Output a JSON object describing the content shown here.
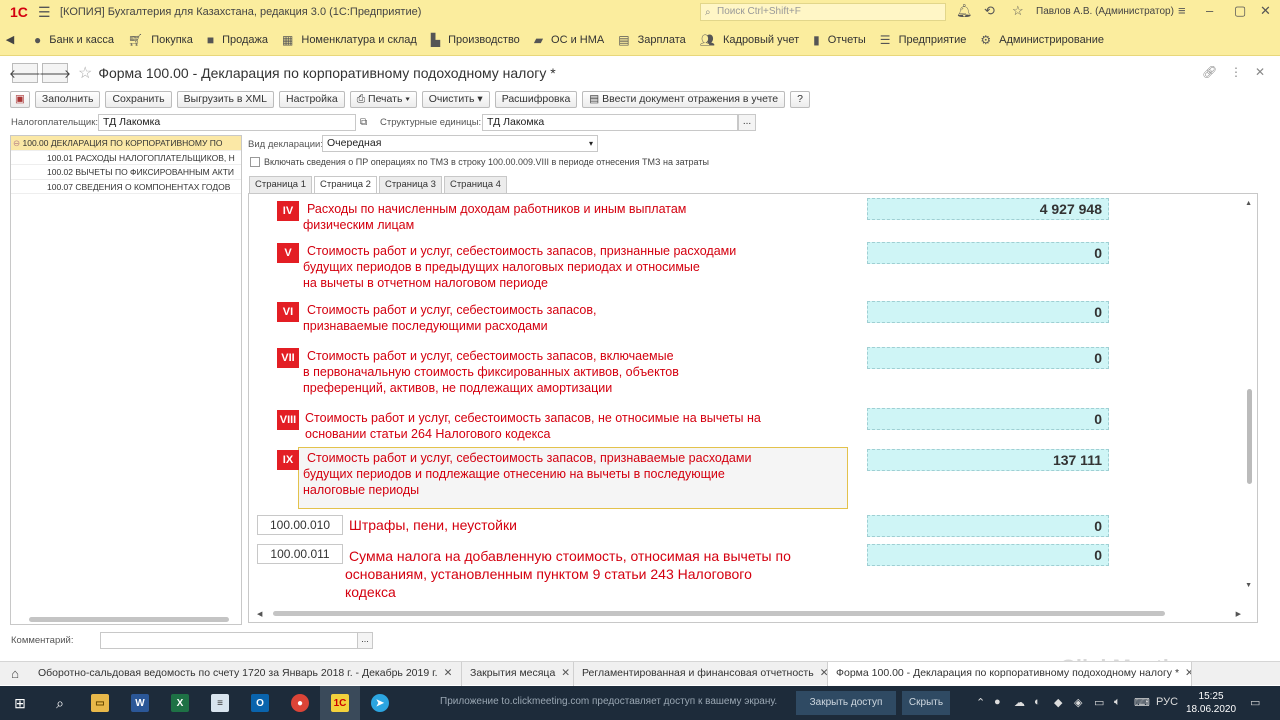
{
  "titlebar": {
    "app_title": "[КОПИЯ] Бухгалтерия для Казахстана, редакция 3.0  (1С:Предприятие)",
    "search_placeholder": "Поиск Ctrl+Shift+F",
    "user": "Павлов А.В. (Администратор)"
  },
  "main_menu": [
    {
      "label": "Банк и касса",
      "icon": "money-icon"
    },
    {
      "label": "Покупка",
      "icon": "cart-icon"
    },
    {
      "label": "Продажа",
      "icon": "bag-icon"
    },
    {
      "label": "Номенклатура и склад",
      "icon": "grid-icon"
    },
    {
      "label": "Производство",
      "icon": "factory-icon"
    },
    {
      "label": "ОС и НМА",
      "icon": "truck-icon"
    },
    {
      "label": "Зарплата",
      "icon": "wallet-icon"
    },
    {
      "label": "Кадровый учет",
      "icon": "people-icon"
    },
    {
      "label": "Отчеты",
      "icon": "bar-chart-icon"
    },
    {
      "label": "Предприятие",
      "icon": "list-icon"
    },
    {
      "label": "Администрирование",
      "icon": "gear-icon"
    }
  ],
  "form": {
    "title": "Форма 100.00 - Декларация по корпоративному подоходному налогу *"
  },
  "toolbar": {
    "fill": "Заполнить",
    "save": "Сохранить",
    "export_xml": "Выгрузить в XML",
    "settings": "Настройка",
    "print": "Печать",
    "clear": "Очистить",
    "decode": "Расшифровка",
    "enter_doc": "Ввести документ отражения в учете",
    "help": "?"
  },
  "payer": {
    "label": "Налогоплательщик:",
    "value": "ТД Лакомка",
    "struct_label": "Структурные единицы:",
    "struct_value": "ТД Лакомка"
  },
  "tree": [
    "100.00 ДЕКЛАРАЦИЯ ПО КОРПОРАТИВНОМУ ПО",
    "100.01 РАСХОДЫ НАЛОГОПЛАТЕЛЬЩИКОВ, Н",
    "100.02 ВЫЧЕТЫ ПО ФИКСИРОВАННЫМ АКТИ",
    "100.07 СВЕДЕНИЯ О КОМПОНЕНТАХ ГОДОВ"
  ],
  "declaration": {
    "type_label": "Вид декларации:",
    "type_value": "Очередная",
    "checkbox_label": "Включать сведения о ПР операциях по ТМЗ в строку 100.00.009.VIII в периоде отнесения ТМЗ на затраты"
  },
  "tabs": [
    "Страница 1",
    "Страница 2",
    "Страница 3",
    "Страница 4"
  ],
  "sections": [
    {
      "badge": "IV",
      "lines": [
        "Расходы по начисленным доходам работников и иным выплатам",
        "физическим лицам"
      ],
      "value": "4 927 948"
    },
    {
      "badge": "V",
      "lines": [
        "Стоимость работ и услуг, себестоимость запасов, признанные расходами",
        "будущих периодов в предыдущих налоговых периодах и относимые",
        "на вычеты в отчетном налоговом периоде"
      ],
      "value": "0"
    },
    {
      "badge": "VI",
      "lines": [
        "Стоимость работ и услуг, себестоимость запасов,",
        "признаваемые последующими расходами"
      ],
      "value": "0"
    },
    {
      "badge": "VII",
      "lines": [
        "Стоимость работ и услуг, себестоимость запасов, включаемые",
        "в первоначальную стоимость фиксированных активов, объектов",
        "преференций, активов, не подлежащих амортизации"
      ],
      "value": "0"
    },
    {
      "badge": "VIII",
      "lines": [
        "Стоимость работ и услуг, себестоимость запасов, не относимые на вычеты на",
        "основании статьи 264 Налогового кодекса"
      ],
      "value": "0"
    },
    {
      "badge": "IX",
      "lines": [
        "Стоимость работ и услуг, себестоимость запасов, признаваемые расходами",
        "будущих периодов и подлежащие отнесению на вычеты в последующие",
        "налоговые периоды"
      ],
      "value": "137 111"
    }
  ],
  "codes": [
    {
      "code": "100.00.010",
      "lines": [
        "Штрафы, пени, неустойки"
      ],
      "value": "0"
    },
    {
      "code": "100.00.011",
      "lines": [
        "Сумма налога на добавленную стоимость, относимая на вычеты по",
        "основаниям, установленным пунктом 9 статьи 243 Налогового",
        "кодекса"
      ],
      "value": "0"
    }
  ],
  "comment": {
    "label": "Комментарий:"
  },
  "open_windows": [
    {
      "label": "Оборотно-сальдовая ведомость по счету 1720  за Январь 2018 г. - Декабрь 2019 г."
    },
    {
      "label": "Закрытия месяца"
    },
    {
      "label": "Регламентированная и финансовая отчетность"
    },
    {
      "label": "Форма 100.00 - Декларация по корпоративному подоходному налогу *"
    }
  ],
  "taskbar": {
    "notice": "Приложение to.clickmeeting.com предоставляет доступ к вашему экрану.",
    "stop_btn": "Закрыть доступ",
    "hide_btn": "Скрыть",
    "lang": "РУС",
    "time": "15:25",
    "date": "18.06.2020"
  },
  "watermark": "ClickMeeting"
}
